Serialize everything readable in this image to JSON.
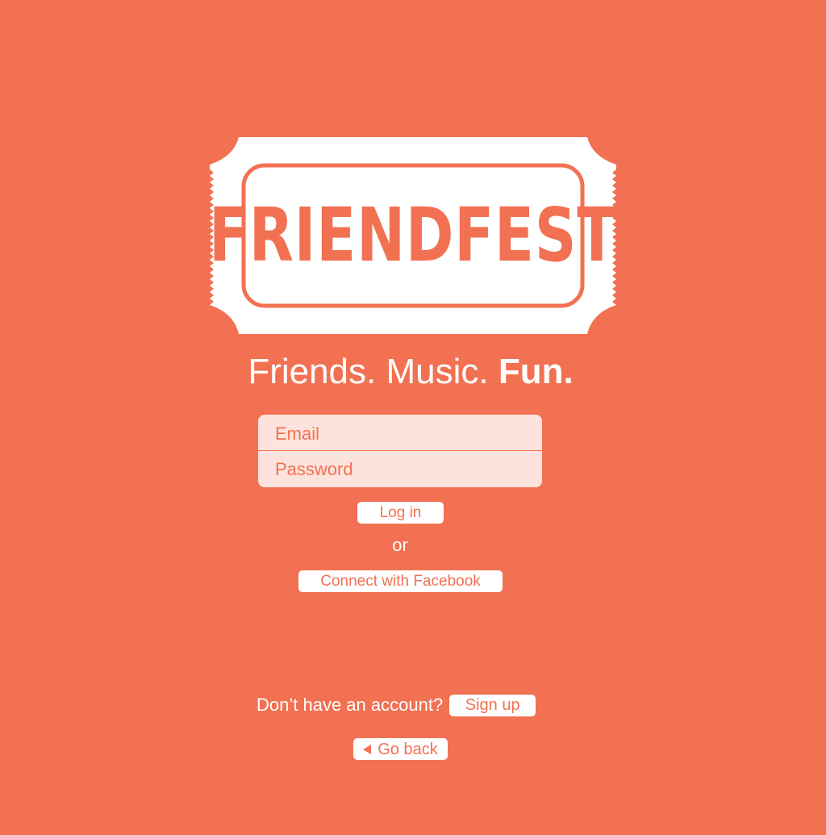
{
  "brand": {
    "logo_text": "FRIENDFEST",
    "tagline_part1": "Friends. Music. ",
    "tagline_part2": "Fun."
  },
  "login_form": {
    "email_placeholder": "Email",
    "password_placeholder": "Password",
    "login_label": "Log in",
    "or_text": "or",
    "facebook_label": "Connect with Facebook"
  },
  "signup": {
    "prompt": "Don’t have an account?",
    "button_label": "Sign up"
  },
  "navigation": {
    "back_label": "Go back",
    "back_icon": "left-triangle-icon"
  },
  "colors": {
    "background": "#f27152",
    "foreground": "#ffffff",
    "input_background": "#fde3dd"
  }
}
